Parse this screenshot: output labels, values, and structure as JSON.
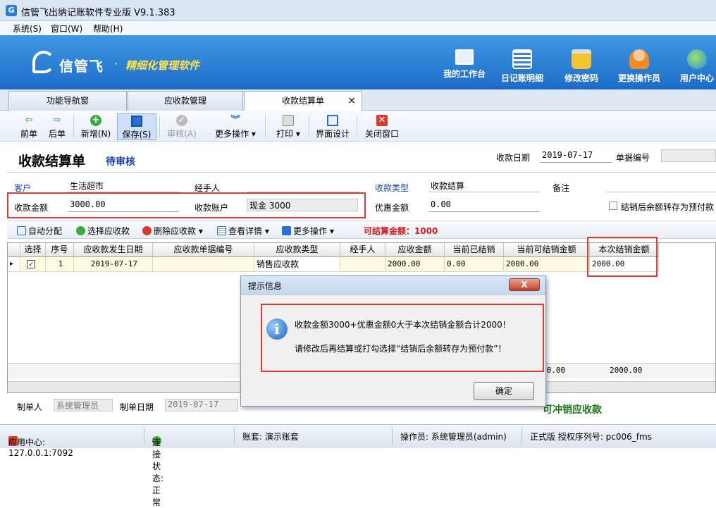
{
  "window": {
    "title": "信管飞出纳记账软件专业版 V9.1.383",
    "app_icon": "G"
  },
  "menu": [
    "系统(S)",
    "窗口(W)",
    "帮助(H)"
  ],
  "banner": {
    "brand": "信管飞",
    "dot": "·",
    "slogan": "精细化管理软件",
    "buttons": [
      {
        "label": "我的工作台",
        "icon": "monitor-icon"
      },
      {
        "label": "日记账明细",
        "icon": "ledger-icon"
      },
      {
        "label": "修改密码",
        "icon": "lock-icon"
      },
      {
        "label": "更换操作员",
        "icon": "user-icon"
      },
      {
        "label": "用户中心",
        "icon": "globe-icon"
      }
    ]
  },
  "tabs": [
    {
      "label": "功能导航窗"
    },
    {
      "label": "应收款管理"
    },
    {
      "label": "收款结算单",
      "close": "×"
    }
  ],
  "toolbar": {
    "prev": "前单",
    "next": "后单",
    "add": "新增(N)",
    "save": "保存(S)",
    "audit": "审核(A)",
    "more": "更多操作",
    "print": "打印",
    "design": "界面设计",
    "close": "关闭窗口"
  },
  "doc": {
    "title": "收款结算单",
    "status": "待审核",
    "date_label": "收款日期",
    "date_value": "2019-07-17",
    "docno_label": "单据编号",
    "docno_value": "",
    "customer_label": "客户",
    "customer_value": "生活超市",
    "handler_label": "经手人",
    "handler_value": "",
    "type_label": "收款类型",
    "type_value": "收款结算",
    "remark_label": "备注",
    "remark_value": "",
    "amount_label": "收款金额",
    "amount_value": "3000.00",
    "account_label": "收款账户",
    "account_value": "现金 3000",
    "discount_label": "优惠金额",
    "discount_value": "0.00",
    "prepay_label": "结销后余额转存为预付款"
  },
  "subtoolbar": {
    "auto": "自动分配",
    "select": "选择应收款",
    "delete": "删除应收款",
    "detail": "查看详情",
    "more": "更多操作",
    "settle_label": "可结算金额：1000"
  },
  "grid": {
    "headers": [
      "选择",
      "序号",
      "应收款发生日期",
      "应收款单据编号",
      "应收款类型",
      "经手人",
      "应收金额",
      "当前已结销",
      "当前可结销金额",
      "本次结销金额"
    ],
    "rows": [
      {
        "marker": "▸",
        "check": "✓",
        "seq": "1",
        "date": "2019-07-17",
        "docno": "",
        "type": "销售应收款",
        "handler": "",
        "amount": "2000.00",
        "settled": "0.00",
        "available": "2000.00",
        "this_time": "2000.00"
      }
    ],
    "totals": {
      "available_partial": "00.00",
      "this_time": "2000.00"
    }
  },
  "footer": {
    "creator_label": "制单人",
    "creator_value": "系统管理员",
    "date_label": "制单日期",
    "date_value": "2019-07-17",
    "hint_partial": "可冲销应收款"
  },
  "dialog": {
    "title": "提示信息",
    "close": "X",
    "icon": "i",
    "line1": "收款金额3000+优惠金额0大于本次结销金额合计2000！",
    "line2": "请修改后再结算或打勾选择“结销后余额转存为预付款”！",
    "ok": "确定"
  },
  "status": {
    "app_center": "应用中心: 127.0.0.1:7092",
    "connection": "连接状态: 正常",
    "book": "账套: 演示账套",
    "operator": "操作员: 系统管理员(admin)",
    "license": "正式版 授权序列号: pc006_fms"
  },
  "colors": {
    "banner": "#1d6cc8",
    "accent_red": "#e53935",
    "status_blue": "#1a3fb8",
    "hint_green": "#1a7a1a"
  }
}
